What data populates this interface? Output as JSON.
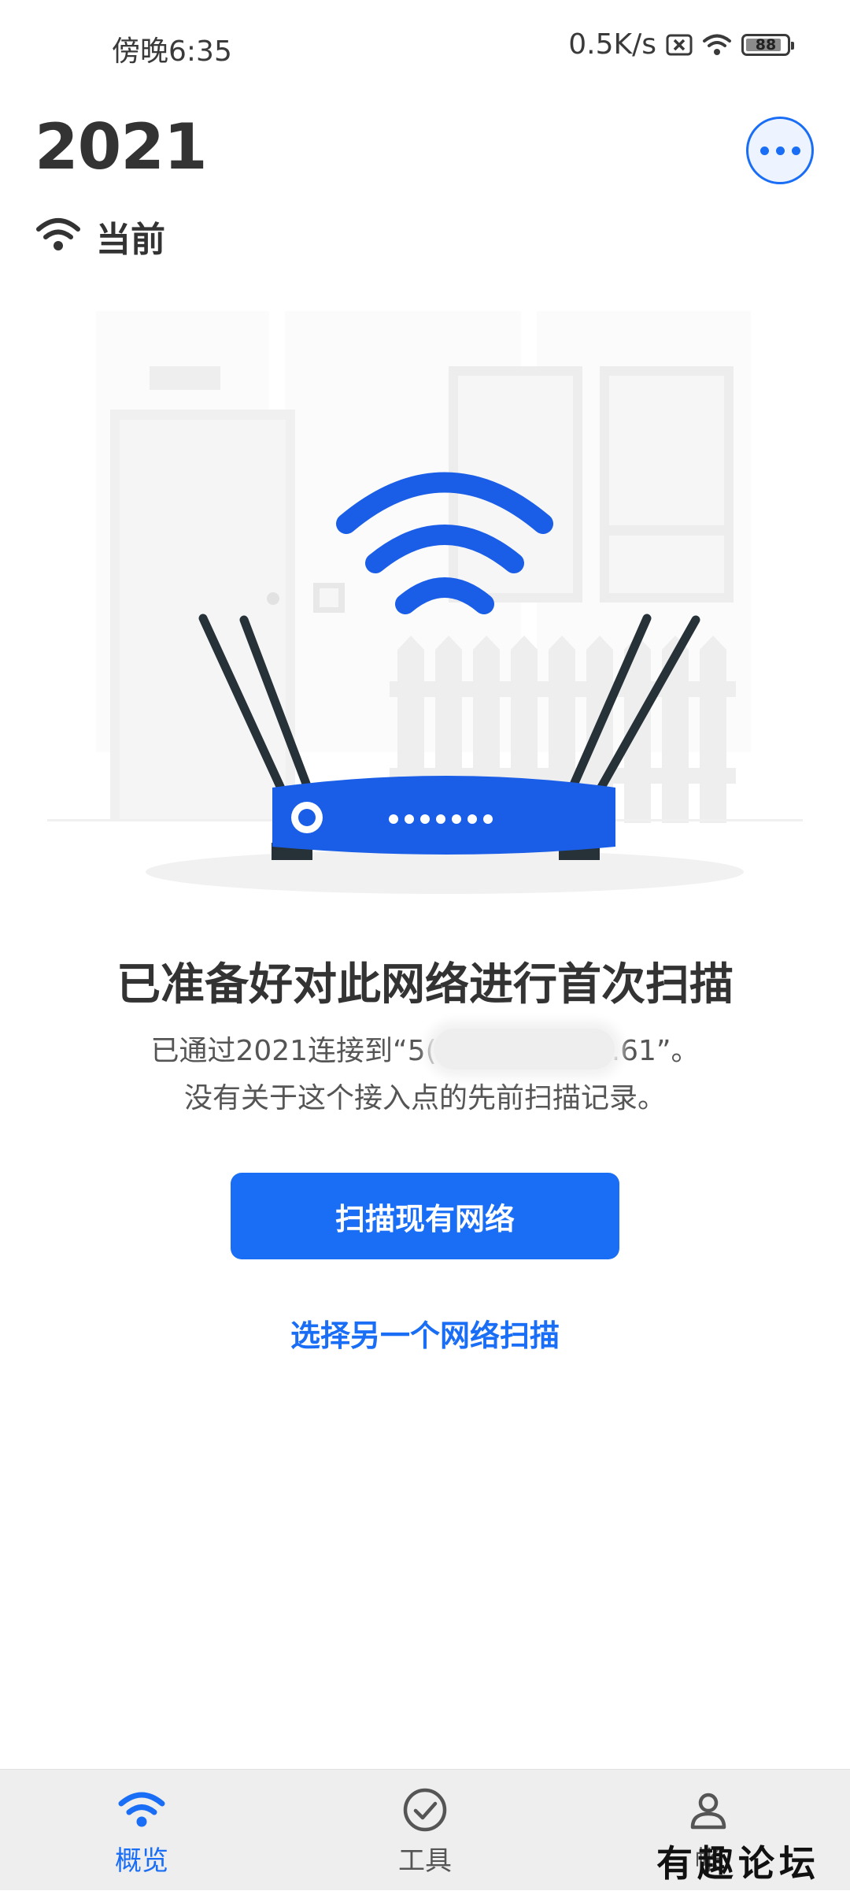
{
  "status_bar": {
    "time": "傍晚6:35",
    "net_speed": "0.5K/s",
    "battery": "88",
    "icons": [
      "sim-x-icon",
      "wifi-icon",
      "battery-icon"
    ]
  },
  "header": {
    "network_name": "2021",
    "status_label": "当前",
    "more_icon": "more-dots-icon"
  },
  "message": {
    "headline": "已准备好对此网络进行首次扫描",
    "line1_prefix": "已通过2021连接到“5(",
    "line1_suffix": ".61”。",
    "line2": "没有关于这个接入点的先前扫描记录。"
  },
  "actions": {
    "scan_button": "扫描现有网络",
    "other_network_link": "选择另一个网络扫描"
  },
  "bottom_nav": {
    "items": [
      {
        "label": "概览",
        "icon": "wifi-icon",
        "active": true
      },
      {
        "label": "工具",
        "icon": "check-circle-icon",
        "active": false
      },
      {
        "label": "帐",
        "icon": "person-icon",
        "active": false
      }
    ]
  },
  "watermark": "有趣论坛",
  "colors": {
    "accent": "#1a6ef5",
    "text": "#333333",
    "nav_background": "#eeeeee"
  }
}
